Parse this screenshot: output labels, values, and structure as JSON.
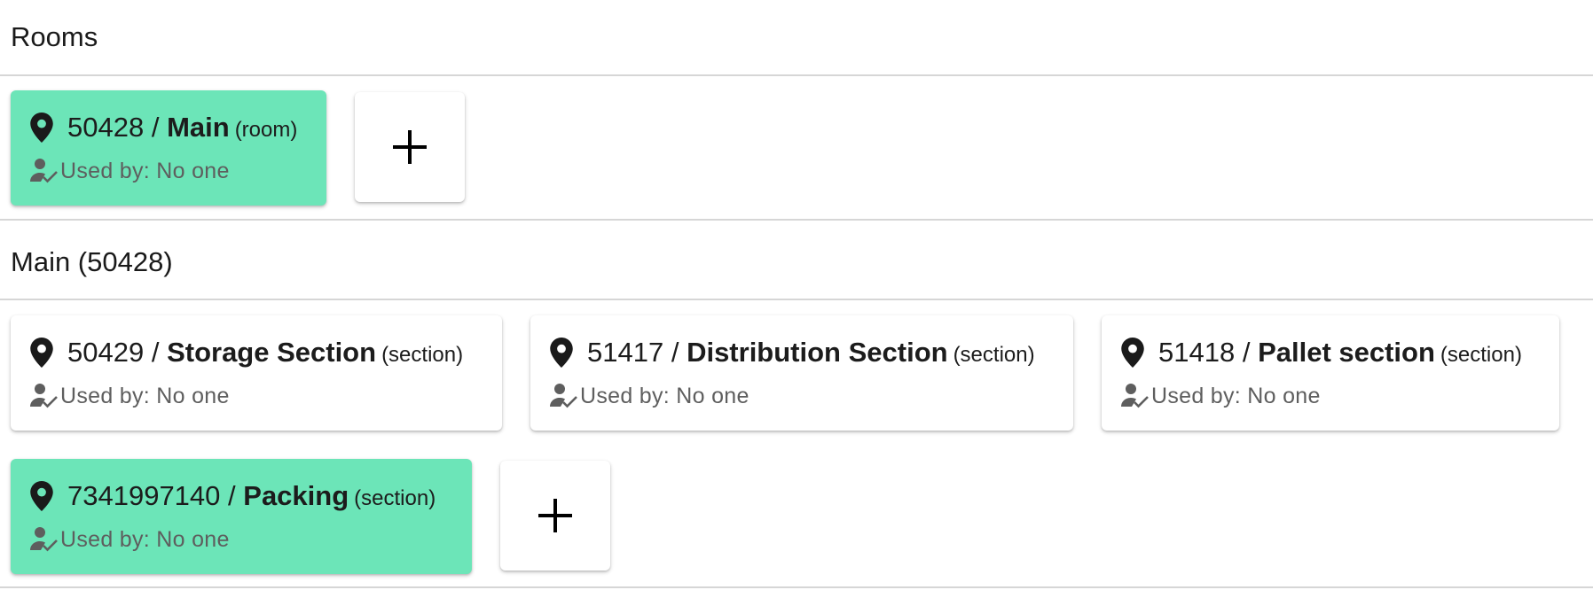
{
  "rooms_section": {
    "header": "Rooms",
    "cards": [
      {
        "id": "50428",
        "name": "Main",
        "kind": "(room)",
        "used_by": "Used by: No one",
        "selected": true
      }
    ]
  },
  "main_section": {
    "header": "Main (50428)",
    "cards": [
      {
        "id": "50429",
        "name": "Storage Section",
        "kind": "(section)",
        "used_by": "Used by: No one",
        "selected": false
      },
      {
        "id": "51417",
        "name": "Distribution Section",
        "kind": "(section)",
        "used_by": "Used by: No one",
        "selected": false
      },
      {
        "id": "51418",
        "name": "Pallet section",
        "kind": "(section)",
        "used_by": "Used by: No one",
        "selected": false
      },
      {
        "id": "7341997140",
        "name": "Packing",
        "kind": "(section)",
        "used_by": "Used by: No one",
        "selected": true
      }
    ]
  },
  "separator": " / ",
  "icons": {
    "location": "location-pin-icon",
    "user_check": "user-check-icon",
    "add": "plus-icon"
  },
  "colors": {
    "selected_card": "#6ce5b8",
    "card": "#ffffff",
    "divider": "#d6d6d6"
  }
}
